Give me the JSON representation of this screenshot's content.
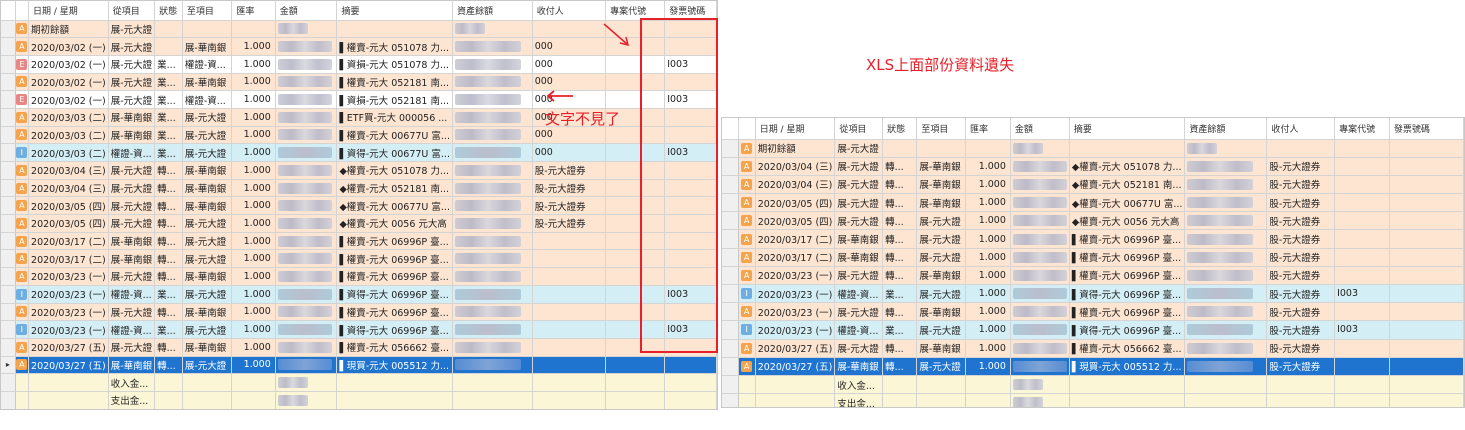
{
  "left_grid": {
    "headers": [
      "日期 / 星期",
      "從項目",
      "狀態",
      "至項目",
      "匯率",
      "金額",
      "摘要",
      "資產餘額",
      "收付人",
      "專案代號",
      "發票號碼"
    ],
    "opening_label": "期初餘額",
    "opening_from": "展-元大證",
    "rows": [
      {
        "type": "A",
        "date": "2020/03/02 (一)",
        "from": "展-元大證",
        "status": "",
        "to": "展-華南銀",
        "rate": "1.000",
        "memo": "▌權賣-元大 051078 力...",
        "payee": "000",
        "invoice": ""
      },
      {
        "type": "E",
        "date": "2020/03/02 (一)",
        "from": "展-元大證",
        "status": "業...",
        "to": "權證-資...",
        "rate": "1.000",
        "memo": "▌資損-元大 051078 力...",
        "payee": "000",
        "invoice": "I003"
      },
      {
        "type": "A",
        "date": "2020/03/02 (一)",
        "from": "展-元大證",
        "status": "業...",
        "to": "展-華南銀",
        "rate": "1.000",
        "memo": "▌權賣-元大 052181 南...",
        "payee": "000",
        "invoice": ""
      },
      {
        "type": "E",
        "date": "2020/03/02 (一)",
        "from": "展-元大證",
        "status": "業...",
        "to": "權證-資...",
        "rate": "1.000",
        "memo": "▌資損-元大 052181 南...",
        "payee": "000",
        "invoice": "I003"
      },
      {
        "type": "A",
        "date": "2020/03/03 (二)",
        "from": "展-華南銀",
        "status": "業...",
        "to": "展-元大證",
        "rate": "1.000",
        "memo": "▌ETF買-元大 000056 ...",
        "payee": "000",
        "invoice": ""
      },
      {
        "type": "A",
        "date": "2020/03/03 (二)",
        "from": "展-華南銀",
        "status": "業...",
        "to": "展-元大證",
        "rate": "1.000",
        "memo": "▌權賣-元大 00677U 富...",
        "payee": "000",
        "invoice": ""
      },
      {
        "type": "I",
        "date": "2020/03/03 (二)",
        "from": "權證-資...",
        "status": "業...",
        "to": "展-元大證",
        "rate": "1.000",
        "memo": "▌資得-元大 00677U 富...",
        "payee": "000",
        "invoice": "I003"
      },
      {
        "type": "A",
        "date": "2020/03/04 (三)",
        "from": "展-元大證",
        "status": "轉...",
        "to": "展-華南銀",
        "rate": "1.000",
        "memo": "◆權賣-元大 051078 力...",
        "payee": "股-元大證券",
        "invoice": ""
      },
      {
        "type": "A",
        "date": "2020/03/04 (三)",
        "from": "展-元大證",
        "status": "轉...",
        "to": "展-華南銀",
        "rate": "1.000",
        "memo": "◆權賣-元大 052181 南...",
        "payee": "股-元大證券",
        "invoice": ""
      },
      {
        "type": "A",
        "date": "2020/03/05 (四)",
        "from": "展-元大證",
        "status": "轉...",
        "to": "展-華南銀",
        "rate": "1.000",
        "memo": "◆權賣-元大 00677U 富...",
        "payee": "股-元大證券",
        "invoice": ""
      },
      {
        "type": "A",
        "date": "2020/03/05 (四)",
        "from": "展-元大證",
        "status": "轉...",
        "to": "展-元大證",
        "rate": "1.000",
        "memo": "◆權賣-元大 0056 元大高",
        "payee": "股-元大證券",
        "invoice": ""
      },
      {
        "type": "A",
        "date": "2020/03/17 (二)",
        "from": "展-華南銀",
        "status": "轉...",
        "to": "展-元大證",
        "rate": "1.000",
        "memo": "▌權賣-元大 06996P 臺...",
        "payee": "",
        "invoice": ""
      },
      {
        "type": "A",
        "date": "2020/03/17 (二)",
        "from": "展-華南銀",
        "status": "轉...",
        "to": "展-元大證",
        "rate": "1.000",
        "memo": "▌權賣-元大 06996P 臺...",
        "payee": "",
        "invoice": ""
      },
      {
        "type": "A",
        "date": "2020/03/23 (一)",
        "from": "展-元大證",
        "status": "轉...",
        "to": "展-華南銀",
        "rate": "1.000",
        "memo": "▌權賣-元大 06996P 臺...",
        "payee": "",
        "invoice": ""
      },
      {
        "type": "I",
        "date": "2020/03/23 (一)",
        "from": "權證-資...",
        "status": "業...",
        "to": "展-元大證",
        "rate": "1.000",
        "memo": "▌資得-元大 06996P 臺...",
        "payee": "",
        "invoice": "I003"
      },
      {
        "type": "A",
        "date": "2020/03/23 (一)",
        "from": "展-元大證",
        "status": "轉...",
        "to": "展-華南銀",
        "rate": "1.000",
        "memo": "▌權賣-元大 06996P 臺...",
        "payee": "",
        "invoice": ""
      },
      {
        "type": "I",
        "date": "2020/03/23 (一)",
        "from": "權證-資...",
        "status": "業...",
        "to": "展-元大證",
        "rate": "1.000",
        "memo": "▌資得-元大 06996P 臺...",
        "payee": "",
        "invoice": "I003"
      },
      {
        "type": "A",
        "date": "2020/03/27 (五)",
        "from": "展-元大證",
        "status": "轉...",
        "to": "展-華南銀",
        "rate": "1.000",
        "memo": "▌權賣-元大 056662 臺...",
        "payee": "",
        "invoice": ""
      },
      {
        "type": "A",
        "date": "2020/03/27 (五)",
        "from": "展-華南銀",
        "status": "轉...",
        "to": "展-元大證",
        "rate": "1.000",
        "memo": "▌現買-元大 005512 力...",
        "payee": "",
        "invoice": "",
        "selected": true
      }
    ],
    "summary": [
      "收入金...",
      "支出金..."
    ],
    "selected_marker": "▸"
  },
  "right_grid": {
    "headers": [
      "日期 / 星期",
      "從項目",
      "狀態",
      "至項目",
      "匯率",
      "金額",
      "摘要",
      "資產餘額",
      "收付人",
      "專案代號",
      "發票號碼"
    ],
    "opening_label": "期初餘額",
    "opening_from": "展-元大證",
    "rows": [
      {
        "type": "A",
        "date": "2020/03/04 (三)",
        "from": "展-元大證",
        "status": "轉...",
        "to": "展-華南銀",
        "rate": "1.000",
        "memo": "◆權賣-元大 051078 力...",
        "payee": "股-元大證券",
        "project": ""
      },
      {
        "type": "A",
        "date": "2020/03/04 (三)",
        "from": "展-元大證",
        "status": "轉...",
        "to": "展-華南銀",
        "rate": "1.000",
        "memo": "◆權賣-元大 052181 南...",
        "payee": "股-元大證券",
        "project": ""
      },
      {
        "type": "A",
        "date": "2020/03/05 (四)",
        "from": "展-元大證",
        "status": "轉...",
        "to": "展-華南銀",
        "rate": "1.000",
        "memo": "◆權賣-元大 00677U 富...",
        "payee": "股-元大證券",
        "project": ""
      },
      {
        "type": "A",
        "date": "2020/03/05 (四)",
        "from": "展-元大證",
        "status": "轉...",
        "to": "展-元大證",
        "rate": "1.000",
        "memo": "◆權賣-元大 0056 元大高",
        "payee": "股-元大證券",
        "project": ""
      },
      {
        "type": "A",
        "date": "2020/03/17 (二)",
        "from": "展-華南銀",
        "status": "轉...",
        "to": "展-元大證",
        "rate": "1.000",
        "memo": "▌權賣-元大 06996P 臺...",
        "payee": "股-元大證券",
        "project": ""
      },
      {
        "type": "A",
        "date": "2020/03/17 (二)",
        "from": "展-華南銀",
        "status": "轉...",
        "to": "展-元大證",
        "rate": "1.000",
        "memo": "▌權賣-元大 06996P 臺...",
        "payee": "股-元大證券",
        "project": ""
      },
      {
        "type": "A",
        "date": "2020/03/23 (一)",
        "from": "展-元大證",
        "status": "轉...",
        "to": "展-華南銀",
        "rate": "1.000",
        "memo": "▌權賣-元大 06996P 臺...",
        "payee": "股-元大證券",
        "project": ""
      },
      {
        "type": "I",
        "date": "2020/03/23 (一)",
        "from": "權證-資...",
        "status": "業...",
        "to": "展-元大證",
        "rate": "1.000",
        "memo": "▌資得-元大 06996P 臺...",
        "payee": "股-元大證券",
        "project": "I003"
      },
      {
        "type": "A",
        "date": "2020/03/23 (一)",
        "from": "展-元大證",
        "status": "轉...",
        "to": "展-華南銀",
        "rate": "1.000",
        "memo": "▌權賣-元大 06996P 臺...",
        "payee": "股-元大證券",
        "project": ""
      },
      {
        "type": "I",
        "date": "2020/03/23 (一)",
        "from": "權證-資...",
        "status": "業...",
        "to": "展-元大證",
        "rate": "1.000",
        "memo": "▌資得-元大 06996P 臺...",
        "payee": "股-元大證券",
        "project": "I003"
      },
      {
        "type": "A",
        "date": "2020/03/27 (五)",
        "from": "展-元大證",
        "status": "轉...",
        "to": "展-華南銀",
        "rate": "1.000",
        "memo": "▌權賣-元大 056662 臺...",
        "payee": "股-元大證券",
        "project": ""
      },
      {
        "type": "A",
        "date": "2020/03/27 (五)",
        "from": "展-華南銀",
        "status": "轉...",
        "to": "展-元大證",
        "rate": "1.000",
        "memo": "▌現買-元大 005512 力...",
        "payee": "股-元大證券",
        "project": "",
        "selected": true
      }
    ],
    "summary": [
      "收入金...",
      "支出金..."
    ]
  },
  "annotations": {
    "text_missing": "文字不見了",
    "xls_missing": "XLS上面部份資料遺失",
    "color": "#e8202a"
  },
  "colors": {
    "row_A": "#fde5d2",
    "row_I": "#d4eef5",
    "row_selected": "#1e74cf",
    "summary_row": "#fbf6d6",
    "badge_A": "#f5a34d",
    "badge_E": "#e88585",
    "badge_I": "#6eaee0"
  }
}
